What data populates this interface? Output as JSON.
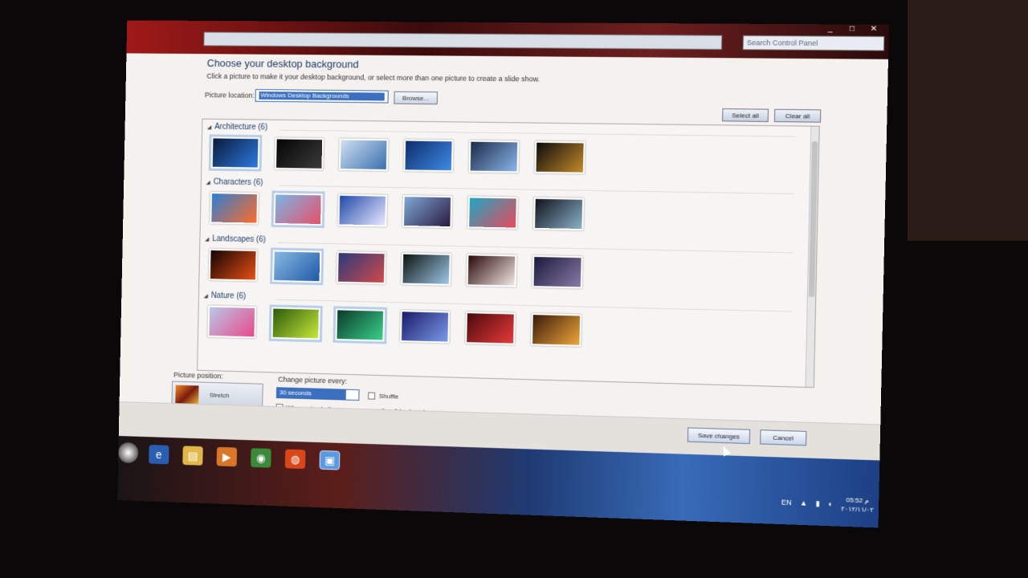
{
  "window": {
    "search_placeholder": "Search Control Panel",
    "controls": [
      "_",
      "□",
      "✕"
    ]
  },
  "page": {
    "title": "Choose your desktop background",
    "description": "Click a picture to make it your desktop background, or select more than one picture to create a slide show.",
    "location_label": "Picture location:",
    "location_value": "Windows Desktop Backgrounds",
    "browse_label": "Browse...",
    "select_all_label": "Select all",
    "clear_all_label": "Clear all"
  },
  "groups": [
    {
      "name": "Architecture (6)",
      "colors": [
        [
          "#0a1a3a",
          "#2c7ae0"
        ],
        [
          "#050505",
          "#3a3a3a"
        ],
        [
          "#cfdff0",
          "#3a6fb0"
        ],
        [
          "#0d2d6b",
          "#3f8ae6"
        ],
        [
          "#1c2a48",
          "#8ab6ec"
        ],
        [
          "#0b0b0b",
          "#c48a2a"
        ]
      ],
      "selected": [
        0
      ]
    },
    {
      "name": "Characters (6)",
      "colors": [
        [
          "#2b7fd3",
          "#ff6a2a"
        ],
        [
          "#7ab6e6",
          "#e8506a"
        ],
        [
          "#2148a8",
          "#e9e9ff"
        ],
        [
          "#7fa8d6",
          "#2a1a40"
        ],
        [
          "#1fa6c4",
          "#e84a5a"
        ],
        [
          "#10121a",
          "#8ab0c8"
        ]
      ],
      "selected": [
        1
      ]
    },
    {
      "name": "Landscapes (6)",
      "colors": [
        [
          "#120404",
          "#e84f13"
        ],
        [
          "#87b9e2",
          "#1e5aa8"
        ],
        [
          "#2a3a7a",
          "#d04a4a"
        ],
        [
          "#0a1410",
          "#9fc7e8"
        ],
        [
          "#2a0808",
          "#f2e8e4"
        ],
        [
          "#1a1a3a",
          "#8a7aa8"
        ]
      ],
      "selected": [
        1
      ]
    },
    {
      "name": "Nature (6)",
      "colors": [
        [
          "#b8c8e8",
          "#e84a8a"
        ],
        [
          "#2a5a0a",
          "#c8e83a"
        ],
        [
          "#0a3a2a",
          "#3ad08a"
        ],
        [
          "#1a1a6a",
          "#7a9ae8"
        ],
        [
          "#4a0a0a",
          "#e83a3a"
        ],
        [
          "#3a1a0a",
          "#f0a63a"
        ]
      ],
      "selected": [
        1,
        2
      ]
    }
  ],
  "options": {
    "position_label": "Picture position:",
    "position_value": "Stretch",
    "change_label": "Change picture every:",
    "change_value": "30 seconds",
    "shuffle_label": "Shuffle",
    "battery_label": "When using battery power, pause the slide show to save power"
  },
  "footer": {
    "save_label": "Save changes",
    "cancel_label": "Cancel"
  },
  "taskbar": {
    "apps": [
      "ie-icon",
      "folder-icon",
      "media-player-icon",
      "chrome-icon",
      "firefox-icon",
      "control-panel-icon"
    ],
    "lang": "EN",
    "time": "05:52 م",
    "date": "٢٠١٢/١١/٠٢"
  }
}
